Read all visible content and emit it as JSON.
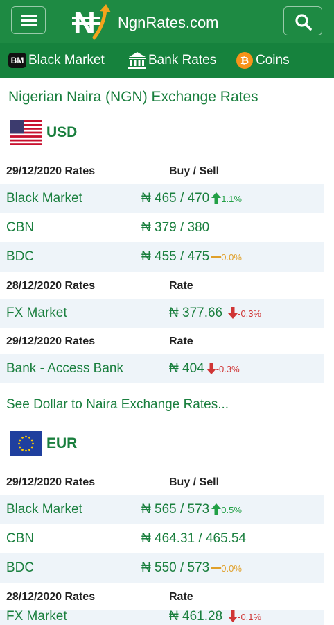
{
  "header": {
    "logo_text": "NgnRates.com",
    "logo_symbol": "₦"
  },
  "nav": {
    "items": [
      {
        "label": "Black Market",
        "icon": "bm-icon",
        "icon_text": "BM"
      },
      {
        "label": "Bank Rates",
        "icon": "bank-icon"
      },
      {
        "label": "Coins",
        "icon": "bitcoin-icon",
        "icon_text": "₿"
      }
    ]
  },
  "page_title": "Nigerian Naira (NGN) Exchange Rates",
  "currencies": [
    {
      "code": "USD",
      "flag": "us-flag-icon",
      "groups": [
        {
          "date": "29/12/2020 Rates",
          "column": "Buy / Sell",
          "rows": [
            {
              "label": "Black Market",
              "value": "₦ 465 / 470",
              "change": "1.1%",
              "trend": "up"
            },
            {
              "label": "CBN",
              "value": "₦ 379 / 380",
              "change": "",
              "trend": ""
            },
            {
              "label": "BDC",
              "value": "₦ 455 / 475",
              "change": "0.0%",
              "trend": "flat"
            }
          ]
        },
        {
          "date": "28/12/2020 Rates",
          "column": "Rate",
          "rows": [
            {
              "label": "FX Market",
              "value": "₦ 377.66",
              "change": "-0.3%",
              "trend": "down"
            }
          ]
        },
        {
          "date": "29/12/2020 Rates",
          "column": "Rate",
          "rows": [
            {
              "label": "Bank - Access Bank",
              "value": "₦ 404",
              "change": "-0.3%",
              "trend": "down"
            }
          ]
        }
      ],
      "link": "See Dollar to Naira Exchange Rates..."
    },
    {
      "code": "EUR",
      "flag": "eu-flag-icon",
      "groups": [
        {
          "date": "29/12/2020 Rates",
          "column": "Buy / Sell",
          "rows": [
            {
              "label": "Black Market",
              "value": "₦ 565 / 573",
              "change": "0.5%",
              "trend": "up"
            },
            {
              "label": "CBN",
              "value": "₦ 464.31 / 465.54",
              "change": "",
              "trend": ""
            },
            {
              "label": "BDC",
              "value": "₦ 550 / 573",
              "change": "0.0%",
              "trend": "flat"
            }
          ]
        },
        {
          "date": "28/12/2020 Rates",
          "column": "Rate",
          "rows": [
            {
              "label": "FX Market",
              "value": "₦ 461.28",
              "change": "-0.1%",
              "trend": "down"
            }
          ]
        }
      ]
    }
  ],
  "colors": {
    "header_green": "#1e8a43",
    "nav_green": "#16823d",
    "text_green": "#1a7f3e",
    "up": "#22a046",
    "down": "#d03535",
    "flat": "#e0a02a",
    "row_shade": "#eef4f9"
  }
}
